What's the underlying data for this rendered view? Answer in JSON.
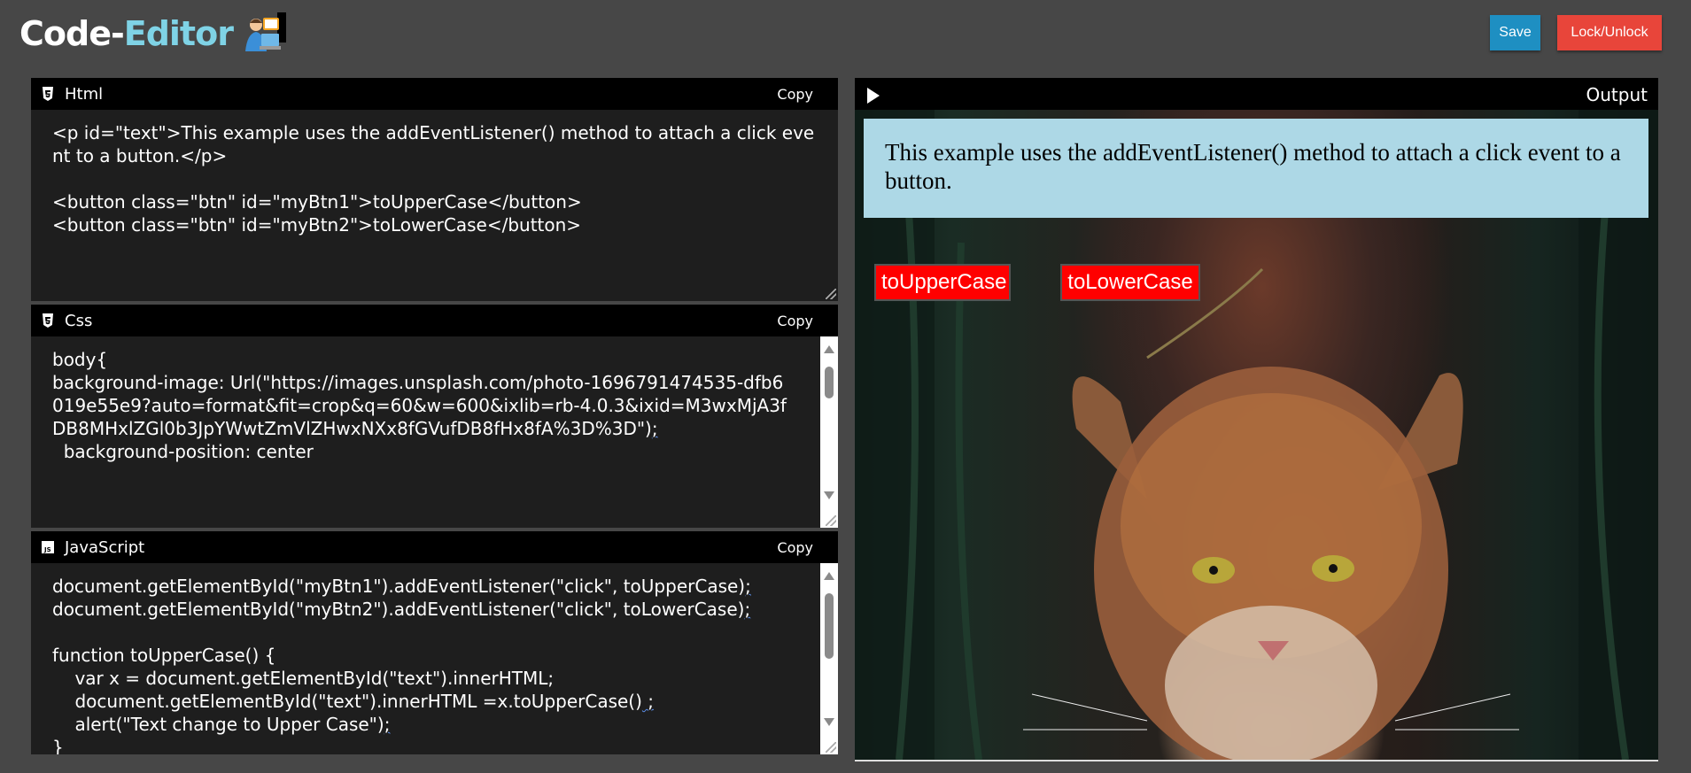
{
  "header": {
    "logo_code": "Code",
    "logo_dash": "-",
    "logo_editor": "Editor",
    "save_label": "Save",
    "lock_label": "Lock/Unlock"
  },
  "html_panel": {
    "title": "Html",
    "copy_label": "Copy",
    "code": "<p id=\"text\">This example uses the addEventListener() method to attach a click event to a button.</p>\n\n<button class=\"btn\" id=\"myBtn1\">toUpperCase</button>\n<button class=\"btn\" id=\"myBtn2\">toLowerCase</button>"
  },
  "css_panel": {
    "title": "Css",
    "copy_label": "Copy",
    "code_lines": [
      "body{",
      "background-image: Url(\"https://images.unsplash.com/photo-1696791474535-dfb6019e55e9?auto=format&fit=crop&q=60&w=600&ixlib=rb-4.0.3&ixid=M3wxMjA3fDB8MHxlZGl0b3JpYWwtZmVlZHwxNXx8fGVufDB8fHx8fA%3D%3D\")",
      ";",
      "  background-position: center"
    ]
  },
  "js_panel": {
    "title": "JavaScript",
    "copy_label": "Copy",
    "lines": [
      {
        "text": "document.getElementById(\"myBtn1\").addEventListener(\"click\", toUpperCase)",
        "tail": ";"
      },
      {
        "text": "document.getElementById(\"myBtn2\").addEventListener(\"click\", toLowerCase)",
        "tail": ";"
      },
      {
        "text": "",
        "tail": ""
      },
      {
        "text": "function toUpperCase() {",
        "tail": ""
      },
      {
        "text": "    var x = document.getElementById(\"text\").innerHTML;",
        "tail": ""
      },
      {
        "text": "    document.getElementById(\"text\").innerHTML =x.toUpperCase()",
        "tail": " ;"
      },
      {
        "text": "    alert(\"Text change to Upper Case\")",
        "tail": ";"
      },
      {
        "text": "}",
        "tail": ""
      }
    ]
  },
  "output": {
    "title": "Output",
    "message": "This example uses the addEventListener() method to attach a click event to a button.",
    "btn1": "toUpperCase",
    "btn2": "toLowerCase"
  },
  "colors": {
    "background": "#474747",
    "save": "#1e8fc2",
    "lock": "#e8453a",
    "message_bg": "#add8e6",
    "output_button": "#ff0000"
  }
}
